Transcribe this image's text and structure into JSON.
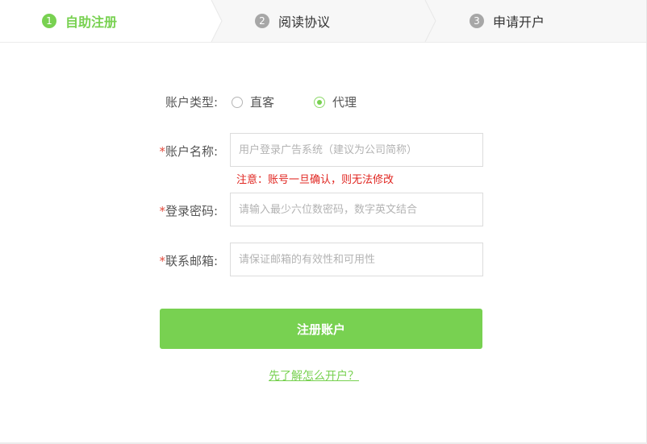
{
  "steps": [
    {
      "num": "1",
      "label": "自助注册",
      "state": "active"
    },
    {
      "num": "2",
      "label": "阅读协议",
      "state": "inactive"
    },
    {
      "num": "3",
      "label": "申请开户",
      "state": "inactive"
    }
  ],
  "form": {
    "account_type": {
      "label": "账户类型:",
      "options": [
        {
          "label": "直客",
          "selected": false
        },
        {
          "label": "代理",
          "selected": true
        }
      ]
    },
    "account_name": {
      "required_mark": "*",
      "label": "账户名称:",
      "placeholder": "用户登录广告系统（建议为公司简称）",
      "value": "",
      "warning": "注意：账号一旦确认，则无法修改"
    },
    "password": {
      "required_mark": "*",
      "label": "登录密码:",
      "placeholder": "请输入最少六位数密码，数字英文结合",
      "value": ""
    },
    "email": {
      "required_mark": "*",
      "label": "联系邮箱:",
      "placeholder": "请保证邮箱的有效性和可用性",
      "value": ""
    },
    "submit_label": "注册账户",
    "help_link": "先了解怎么开户？"
  },
  "colors": {
    "accent": "#78d151",
    "warning": "#e0241f",
    "required": "#e24a3c",
    "step_inactive": "#a7a7a7"
  }
}
